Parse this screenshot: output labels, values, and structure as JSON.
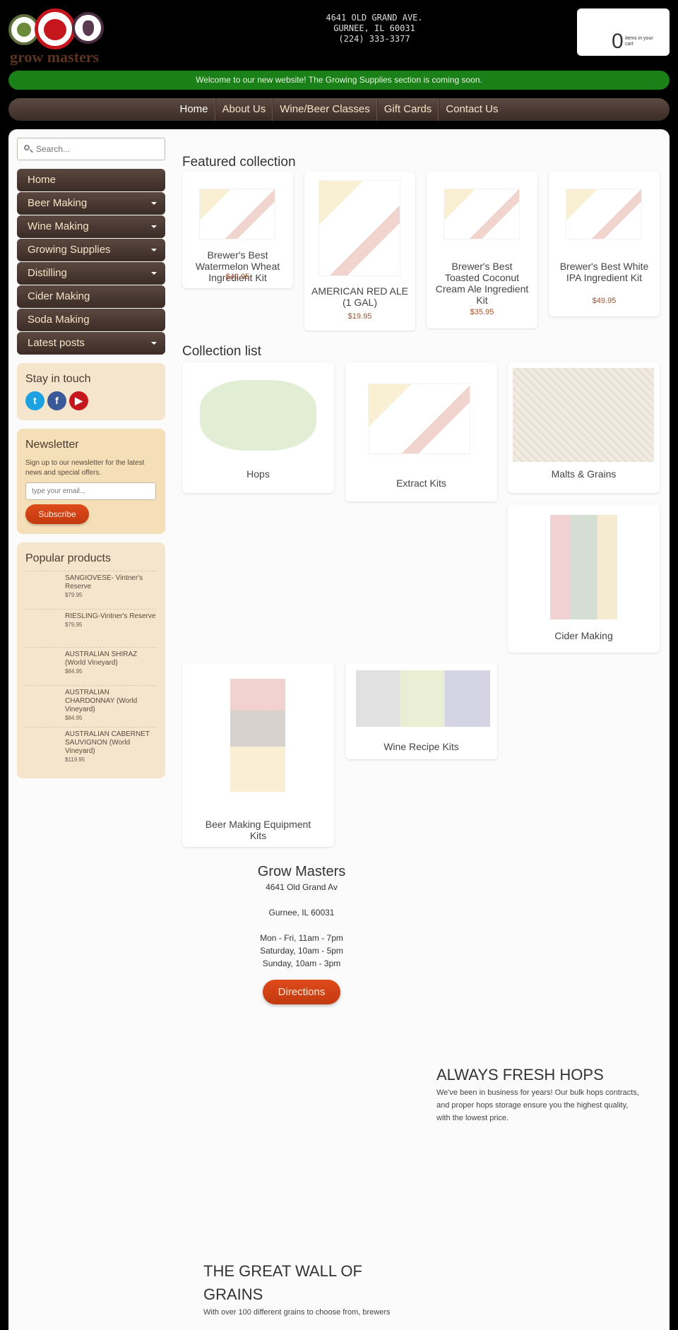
{
  "header": {
    "logo_text": "grow masters",
    "address_lines": [
      "4641 OLD GRAND AVE.",
      "GURNEE, IL 60031",
      "(224) 333-3377"
    ],
    "cart": {
      "count": "0",
      "label": "items in your cart"
    }
  },
  "banner": "Welcome to our new website! The Growing Supplies section is coming soon.",
  "nav": [
    "Home",
    "About Us",
    "Wine/Beer Classes",
    "Gift Cards",
    "Contact Us"
  ],
  "sidebar": {
    "search_placeholder": "Search...",
    "menu": [
      {
        "label": "Home",
        "dropdown": false
      },
      {
        "label": "Beer Making",
        "dropdown": true
      },
      {
        "label": "Wine Making",
        "dropdown": true
      },
      {
        "label": "Growing Supplies",
        "dropdown": true
      },
      {
        "label": "Distilling",
        "dropdown": true
      },
      {
        "label": "Cider Making",
        "dropdown": false
      },
      {
        "label": "Soda Making",
        "dropdown": false
      },
      {
        "label": "Latest posts",
        "dropdown": true
      }
    ],
    "stay_in_touch": {
      "title": "Stay in touch",
      "icons": [
        "twitter-icon",
        "facebook-icon",
        "youtube-icon"
      ]
    },
    "newsletter": {
      "title": "Newsletter",
      "text": "Sign up to our newsletter for the latest news and special offers.",
      "placeholder": "type your email...",
      "button": "Subscribe"
    },
    "popular": {
      "title": "Popular products",
      "items": [
        {
          "name": "SANGIOVESE- Vintner's Reserve",
          "price": "$79.95"
        },
        {
          "name": "RIESLING-Vintner's Reserve",
          "price": "$79.95"
        },
        {
          "name": "AUSTRALIAN SHIRAZ (World Vineyard)",
          "price": "$84.95"
        },
        {
          "name": "AUSTRALIAN CHARDONNAY (World Vineyard)",
          "price": "$84.95"
        },
        {
          "name": "AUSTRALIAN CABERNET SAUVIGNON (World Vineyard)",
          "price": "$119.95"
        }
      ]
    }
  },
  "featured": {
    "title": "Featured collection",
    "products": [
      {
        "name": "Brewer's Best Watermelon Wheat Ingredient Kit",
        "price": "$42.95"
      },
      {
        "name": "AMERICAN RED ALE (1 GAL)",
        "price": "$19.95"
      },
      {
        "name": "Brewer's Best Toasted Coconut Cream Ale Ingredient Kit",
        "price": "$35.95"
      },
      {
        "name": "Brewer's Best White IPA Ingredient Kit",
        "price": "$49.95"
      }
    ]
  },
  "collections": {
    "title": "Collection list",
    "items": [
      "Hops",
      "Extract Kits",
      "Malts & Grains",
      "Cider Making",
      "Beer Making Equipment Kits",
      "Wine Recipe Kits"
    ]
  },
  "store": {
    "name": "Grow Masters",
    "address1": "4641 Old Grand Av",
    "address2": "Gurnee, IL 60031",
    "hours": [
      "Mon - Fri, 11am - 7pm",
      "Saturday, 10am - 5pm",
      "Sunday, 10am - 3pm"
    ],
    "button": "Directions"
  },
  "features": [
    {
      "title": "ALWAYS FRESH HOPS",
      "text": "We've been in business for years! Our bulk hops contracts, and proper hops storage ensure you the highest quality, with the lowest price."
    },
    {
      "title": "THE GREAT WALL OF GRAINS",
      "text": "With over 100 different grains to choose from, brewers"
    }
  ],
  "colors": {
    "banner": "#1a8018",
    "nav": "#4a3a33",
    "accent": "#d04418",
    "price": "#a0522d"
  }
}
